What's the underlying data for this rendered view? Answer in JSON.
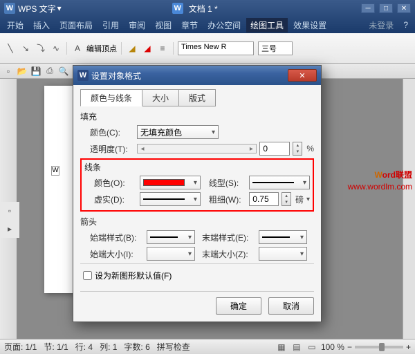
{
  "app": {
    "name": "WPS 文字",
    "doc_title": "文档 1 *"
  },
  "menu": {
    "items": [
      "开始",
      "插入",
      "页面布局",
      "引用",
      "审阅",
      "视图",
      "章节",
      "办公空间",
      "绘图工具",
      "效果设置",
      "未登录"
    ],
    "active_index": 8
  },
  "ribbon": {
    "font": "Times New R",
    "size": "三号",
    "edit_vertex": "编辑顶点"
  },
  "dialog": {
    "title": "设置对象格式",
    "tabs": [
      "颜色与线条",
      "大小",
      "版式"
    ],
    "active_tab": 0,
    "fill": {
      "group": "填充",
      "color_label": "颜色(C):",
      "color_value": "无填充颜色",
      "trans_label": "透明度(T):",
      "trans_value": "0",
      "trans_unit": "%"
    },
    "line": {
      "group": "线条",
      "color_label": "颜色(O):",
      "style_label": "线型(S):",
      "dash_label": "虚实(D):",
      "weight_label": "粗细(W):",
      "weight_value": "0.75",
      "weight_unit": "磅"
    },
    "arrow": {
      "group": "箭头",
      "begin_style": "始端样式(B):",
      "end_style": "末端样式(E):",
      "begin_size": "始端大小(I):",
      "end_size": "末端大小(Z):"
    },
    "default_chk": "设为新图形默认值(F)",
    "ok": "确定",
    "cancel": "取消"
  },
  "status": {
    "page": "页面: 1/1",
    "section": "节: 1/1",
    "line": "行: 4",
    "col": "列: 1",
    "words": "字数: 6",
    "spell": "拼写检查",
    "zoom": "100 %"
  },
  "watermark": {
    "word": "W",
    "rest": "ord联盟",
    "url": "www.wordlm.com"
  },
  "page_content": "W"
}
